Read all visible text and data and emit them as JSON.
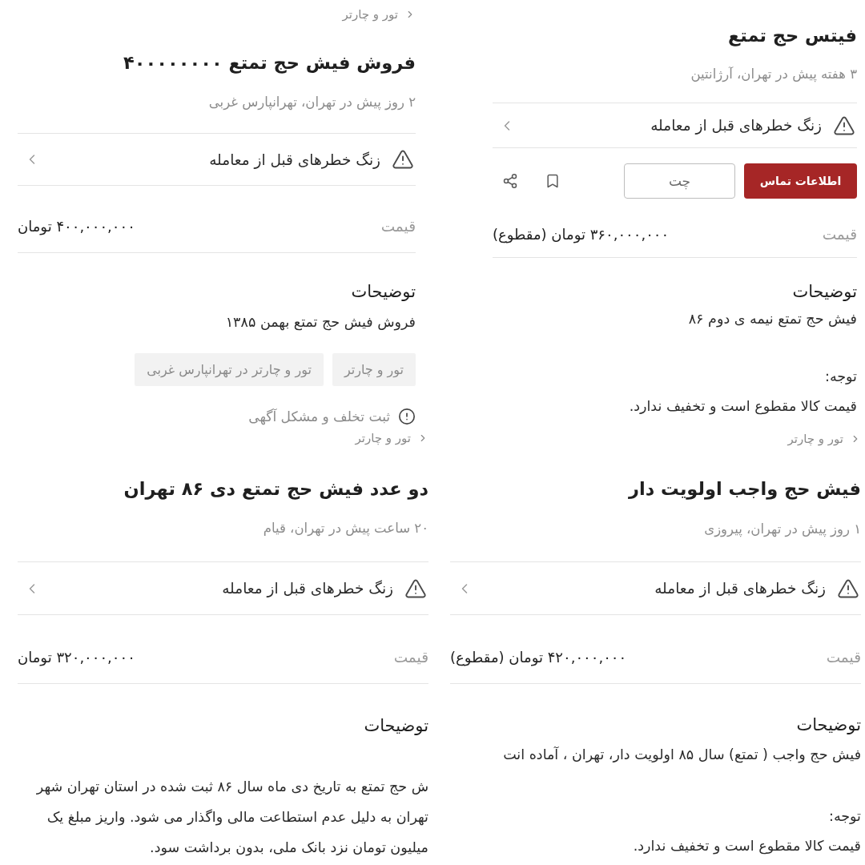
{
  "listings": [
    {
      "title": "فیتس حج تمتع",
      "meta": "۳ هفته پیش در تهران، آرژانتین",
      "safety_tip": "زنگ خطرهای قبل از معامله",
      "actions": {
        "contact": "اطلاعات تماس",
        "chat": "چت"
      },
      "price": {
        "label": "قیمت",
        "value": "۳۶۰,۰۰۰,۰۰۰ تومان (مقطوع)"
      },
      "description": {
        "heading": "توضیحات",
        "text": "فیش حج تمتع نیمه ی دوم ۸۶"
      },
      "note": {
        "label": "توجه:",
        "text": "قیمت کالا مقطوع است و تخفیف ندارد."
      }
    },
    {
      "breadcrumb": "تور و چارتر",
      "title": "فروش فیش حج تمتع ۴۰۰۰۰۰۰۰۰",
      "meta": "۲ روز پیش در تهران، تهرانپارس غربی",
      "safety_tip": "زنگ خطرهای قبل از معامله",
      "price": {
        "label": "قیمت",
        "value": "۴۰۰,۰۰۰,۰۰۰ تومان"
      },
      "description": {
        "heading": "توضیحات",
        "text": "فروش فیش حج تمتع بهمن ۱۳۸۵"
      },
      "tags": [
        "تور و چارتر",
        "تور و چارتر در تهرانپارس غربی"
      ],
      "report": "ثبت تخلف و مشکل آگهی"
    },
    {
      "breadcrumb": "تور و چارتر",
      "title": "فیش حج واجب اولویت دار",
      "meta": "۱ روز پیش در تهران، پیروزی",
      "safety_tip": "زنگ خطرهای قبل از معامله",
      "price": {
        "label": "قیمت",
        "value": "۴۲۰,۰۰۰,۰۰۰ تومان (مقطوع)"
      },
      "description": {
        "heading": "توضیحات",
        "text": "فیش حج واجب ( تمتع) سال ۸۵ اولویت دار، تهران ، آماده انت"
      },
      "note": {
        "label": "توجه:",
        "text": "قیمت کالا مقطوع است و تخفیف ندارد."
      }
    },
    {
      "breadcrumb": "تور و چارتر",
      "title": "دو عدد فیش حج تمتع دی ۸۶ تهران",
      "meta": "۲۰ ساعت پیش در تهران، قیام",
      "safety_tip": "زنگ خطرهای قبل از معامله",
      "price": {
        "label": "قیمت",
        "value": "۳۲۰,۰۰۰,۰۰۰ تومان"
      },
      "description": {
        "heading": "توضیحات",
        "text": "ش حج تمتع به تاریخ دی ماه سال ۸۶ ثبت شده در استان تهران شهر تهران به دلیل عدم استطاعت مالی واگذار می شود. واریز مبلغ یک میلیون تومان نزد بانک ملی، بدون برداشت سود."
      }
    }
  ]
}
